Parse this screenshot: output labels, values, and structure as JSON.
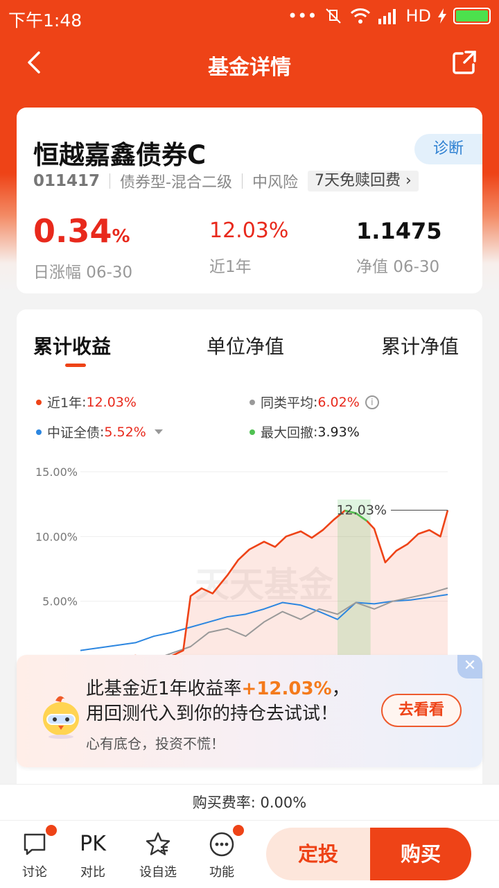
{
  "status_bar": {
    "time": "下午1:48",
    "network": "HD"
  },
  "nav": {
    "title": "基金详情"
  },
  "fund": {
    "name": "恒越嘉鑫债券C",
    "diagnose_label": "诊断",
    "code": "011417",
    "type": "债券型-混合二级",
    "risk": "中风险",
    "fee_tag": "7天免赎回费",
    "daily_change": "0.34",
    "daily_change_unit": "%",
    "daily_change_label": "日涨幅 06-30",
    "year_return": "12.03%",
    "year_return_label": "近1年",
    "nav": "1.1475",
    "nav_label": "净值 06-30"
  },
  "tabs": [
    {
      "label": "累计收益"
    },
    {
      "label": "单位净值"
    },
    {
      "label": "累计净值"
    }
  ],
  "legend": {
    "fund": {
      "name": "近1年",
      "value": "12.03%",
      "color": "#ee4317"
    },
    "peer": {
      "name": "同类平均",
      "value": "6.02%",
      "color": "#999999"
    },
    "index": {
      "name": "中证全债",
      "value": "5.52%",
      "color": "#2c86e0"
    },
    "drawdown": {
      "name": "最大回撤",
      "value": "3.93%",
      "color": "#4fc152"
    }
  },
  "chart_data": {
    "type": "line",
    "title": "",
    "xlabel": "",
    "ylabel": "",
    "y_ticks": [
      "15.00%",
      "10.00%",
      "5.00%"
    ],
    "ylim": [
      0,
      15
    ],
    "max_label": "12.03%",
    "watermark": "天天基金",
    "series": [
      {
        "name": "近1年",
        "color": "#ee4317",
        "x": [
          0,
          0.05,
          0.1,
          0.15,
          0.18,
          0.2,
          0.22,
          0.25,
          0.28,
          0.3,
          0.33,
          0.36,
          0.4,
          0.43,
          0.46,
          0.5,
          0.53,
          0.56,
          0.6,
          0.63,
          0.66,
          0.69,
          0.72,
          0.75,
          0.78,
          0.8,
          0.83,
          0.86,
          0.89,
          0.92,
          0.95,
          0.98,
          1.0
        ],
        "values": [
          0.4,
          0.5,
          0.6,
          0.8,
          0.6,
          0.5,
          0.7,
          0.8,
          1.2,
          5.4,
          6.0,
          5.6,
          7.0,
          8.2,
          9.0,
          9.6,
          9.2,
          10.0,
          10.4,
          9.9,
          10.5,
          11.3,
          12.0,
          11.8,
          11.2,
          10.6,
          8.0,
          8.9,
          9.4,
          10.2,
          10.5,
          10.0,
          12.03
        ]
      },
      {
        "name": "同类平均",
        "color": "#999999",
        "x": [
          0,
          0.1,
          0.2,
          0.3,
          0.35,
          0.4,
          0.45,
          0.5,
          0.55,
          0.6,
          0.65,
          0.7,
          0.75,
          0.8,
          0.85,
          0.9,
          0.95,
          1.0
        ],
        "values": [
          0.3,
          0.4,
          0.5,
          1.5,
          2.6,
          2.9,
          2.3,
          3.4,
          4.2,
          3.6,
          4.4,
          4.0,
          4.9,
          4.4,
          5.0,
          5.3,
          5.6,
          6.02
        ]
      },
      {
        "name": "中证全债",
        "color": "#2c86e0",
        "x": [
          0,
          0.05,
          0.1,
          0.15,
          0.2,
          0.25,
          0.3,
          0.35,
          0.4,
          0.45,
          0.5,
          0.55,
          0.6,
          0.65,
          0.7,
          0.75,
          0.8,
          0.85,
          0.9,
          0.95,
          1.0
        ],
        "values": [
          1.2,
          1.4,
          1.6,
          1.8,
          2.3,
          2.6,
          3.0,
          3.4,
          3.8,
          4.0,
          4.4,
          4.9,
          4.7,
          4.2,
          3.6,
          4.9,
          4.8,
          5.0,
          5.1,
          5.3,
          5.52
        ]
      }
    ],
    "drawdown_range": [
      0.7,
      0.79
    ]
  },
  "promo": {
    "line1_prefix": "此基金近1年收益率",
    "line1_highlight": "+12.03%",
    "line1_suffix": "，",
    "line2": "用回测代入到你的持仓去试试！",
    "line3": "心有底仓，投资不慌！",
    "button": "去看看",
    "close": "✕"
  },
  "purchase_fee": "购买费率: 0.00%",
  "bottom_bar": {
    "items": [
      {
        "label": "讨论",
        "icon": "chat-icon"
      },
      {
        "label": "对比",
        "icon": "pk-icon",
        "text": "PK"
      },
      {
        "label": "设自选",
        "icon": "star-icon"
      },
      {
        "label": "功能",
        "icon": "more-icon"
      }
    ],
    "dingtou": "定投",
    "buy": "购买"
  }
}
